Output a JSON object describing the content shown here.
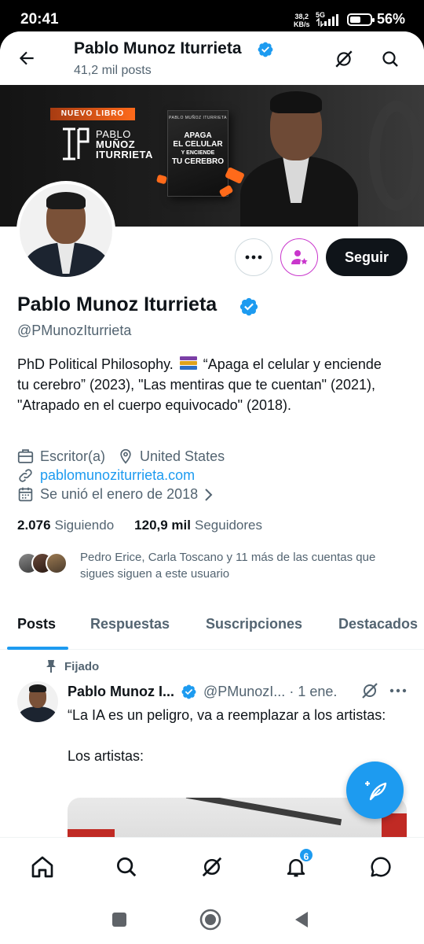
{
  "status_bar": {
    "time": "20:41",
    "net_speed_value": "38,2",
    "net_speed_unit": "KB/s",
    "network": "5G",
    "battery": "56%",
    "battery_level": 0.56
  },
  "header": {
    "title": "Pablo Munoz Iturrieta",
    "subtitle": "41,2 mil posts"
  },
  "banner": {
    "tag": "NUEVO LIBRO",
    "author_line1": "PABLO",
    "author_line2": "MUÑOZ",
    "author_line3": "ITURRIETA",
    "book_author": "PABLO MUÑOZ ITURRIETA",
    "book_title_1": "APAGA",
    "book_title_2": "EL CELULAR",
    "book_title_3": "Y ENCIENDE",
    "book_title_4": "TU CEREBRO"
  },
  "actions": {
    "follow_label": "Seguir"
  },
  "profile": {
    "name": "Pablo Munoz Iturrieta",
    "handle": "@PMunozIturrieta",
    "bio_part1": "PhD Political Philosophy.",
    "bio_part2": "“Apaga el celular y enciende tu cerebro” (2023), \"Las mentiras que te cuentan\" (2021), \"Atrapado en el cuerpo equivocado\" (2018).",
    "occupation": "Escritor(a)",
    "location": "United States",
    "website": "pablomunoziturrieta.com",
    "joined": "Se unió el enero de 2018",
    "following_count": "2.076",
    "following_label": "Siguiendo",
    "followers_count": "120,9 mil",
    "followers_label": "Seguidores",
    "followed_by": "Pedro Erice, Carla Toscano y 11 más de las cuentas que sigues siguen a este usuario"
  },
  "tabs": [
    {
      "label": "Posts",
      "active": true
    },
    {
      "label": "Respuestas",
      "active": false
    },
    {
      "label": "Suscripciones",
      "active": false
    },
    {
      "label": "Destacados",
      "active": false
    }
  ],
  "post": {
    "pinned_label": "Fijado",
    "author": "Pablo Munoz I...",
    "handle": "@PMunozI...",
    "separator": "·",
    "date": "1 ene.",
    "text": "“La IA es un peligro, va a reemplazar a los artistas:\n\nLos artistas:"
  },
  "bottom_nav": {
    "items": [
      "home-icon",
      "search-icon",
      "grok-icon",
      "notifications-icon",
      "messages-icon"
    ],
    "notifications_badge": "6"
  },
  "colors": {
    "accent": "#1d9bf0",
    "text_primary": "#0f1419",
    "text_secondary": "#536471",
    "subscribe_accent": "#c936cc"
  }
}
